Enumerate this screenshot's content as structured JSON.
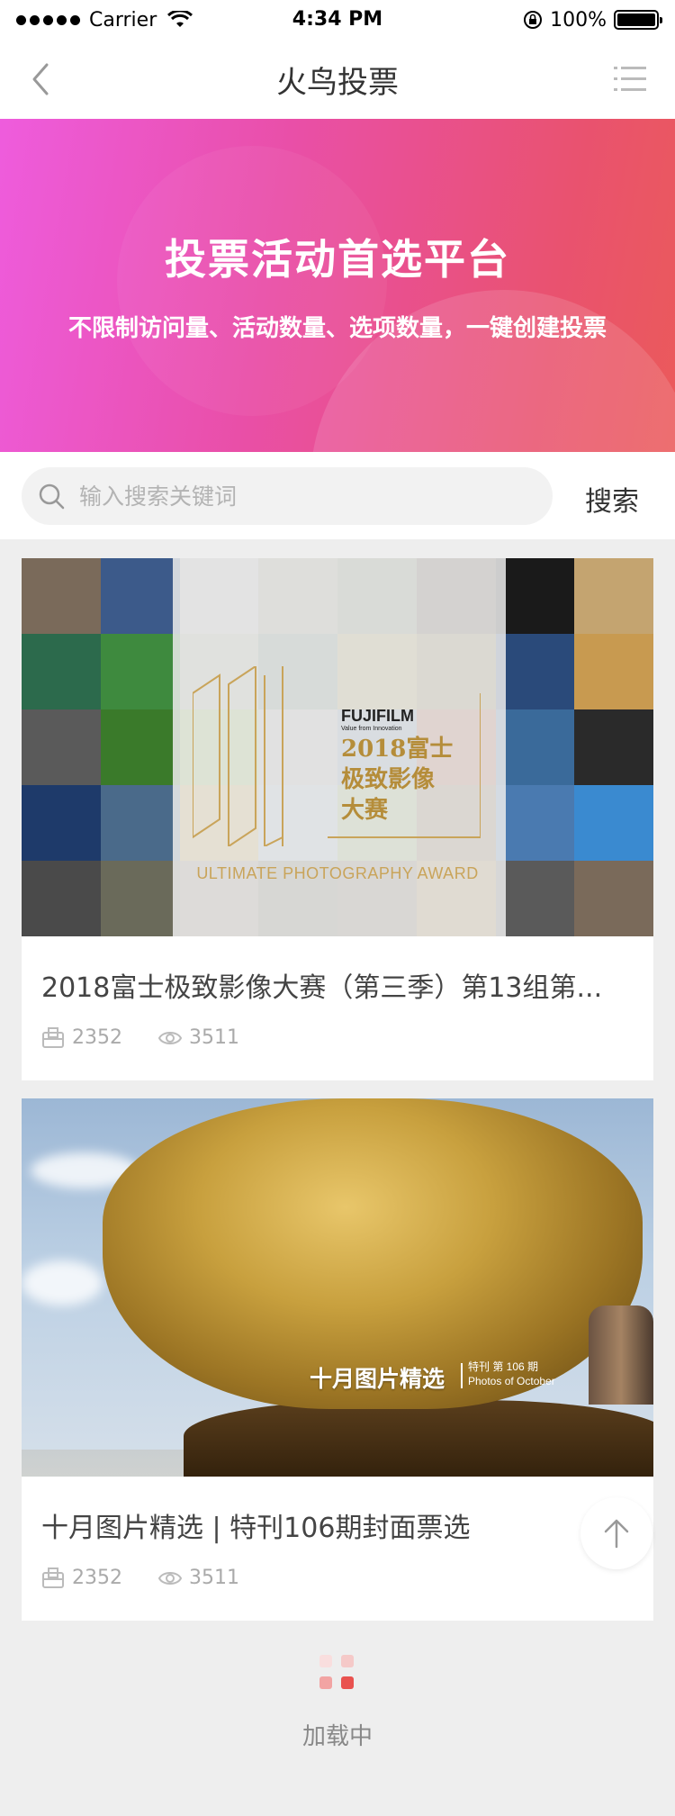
{
  "status_bar": {
    "carrier": "Carrier",
    "time": "4:34 PM",
    "battery": "100%"
  },
  "nav": {
    "title": "火鸟投票",
    "back_icon": "chevron-left-icon",
    "menu_icon": "list-menu-icon"
  },
  "banner": {
    "title": "投票活动首选平台",
    "subtitle": "不限制访问量、活动数量、选项数量，一键创建投票"
  },
  "search": {
    "placeholder": "输入搜索关键词",
    "button": "搜索"
  },
  "cards": [
    {
      "title": "2018富士极致影像大赛（第三季）第13组第...",
      "votes": "2352",
      "views": "3511",
      "image": {
        "brand": "FUJIFILM",
        "brand_tagline": "Value from Innovation",
        "heading_line1": "2018富士",
        "heading_line2": "极致影像",
        "heading_line3": "大赛",
        "award": "ULTIMATE PHOTOGRAPHY AWARD"
      }
    },
    {
      "title": "十月图片精选 | 特刊106期封面票选",
      "votes": "2352",
      "views": "3511",
      "image": {
        "headline": "十月图片精选",
        "issue": "特刊 第 106 期",
        "caption": "Photos of October"
      }
    }
  ],
  "loading": {
    "text": "加载中"
  },
  "colors": {
    "banner_start": "#ee5cdd",
    "banner_end": "#eb5a5a",
    "loader_active": "#e9524f",
    "loader_faint": "#f5c9c8"
  }
}
